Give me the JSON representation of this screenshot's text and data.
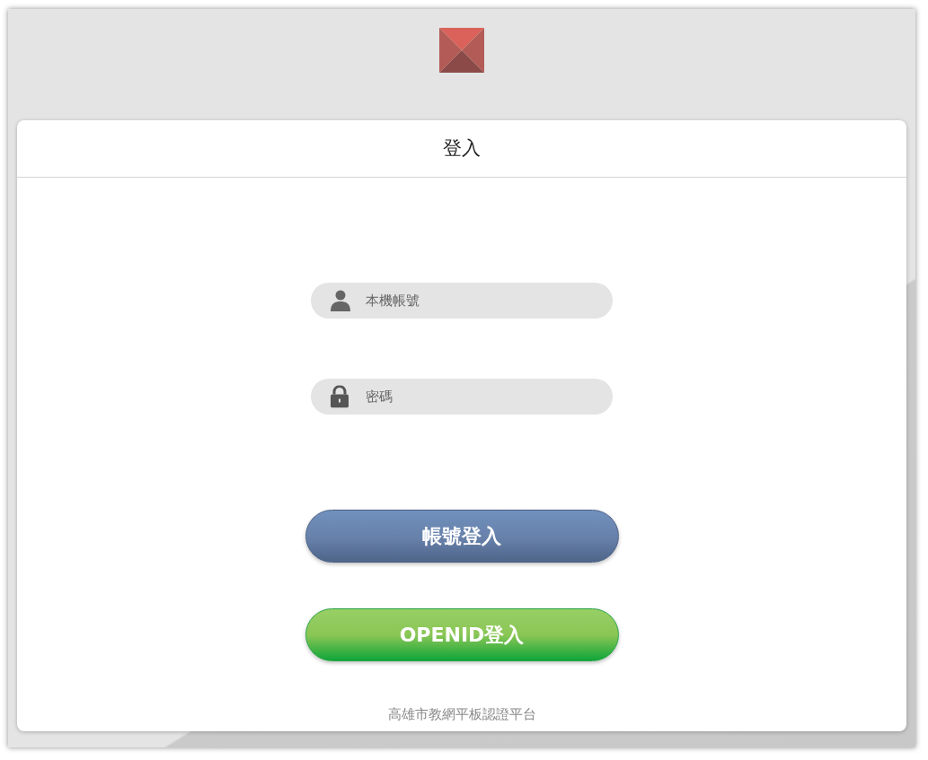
{
  "card": {
    "title": "登入"
  },
  "fields": [
    {
      "kind": "account",
      "placeholder": "本機帳號"
    },
    {
      "kind": "password",
      "placeholder": "密碼"
    }
  ],
  "buttons": [
    {
      "kind": "account",
      "label": "帳號登入"
    },
    {
      "kind": "openid",
      "label": "OPENID登入"
    }
  ],
  "footer": "高雄市教網平板認證平台"
}
